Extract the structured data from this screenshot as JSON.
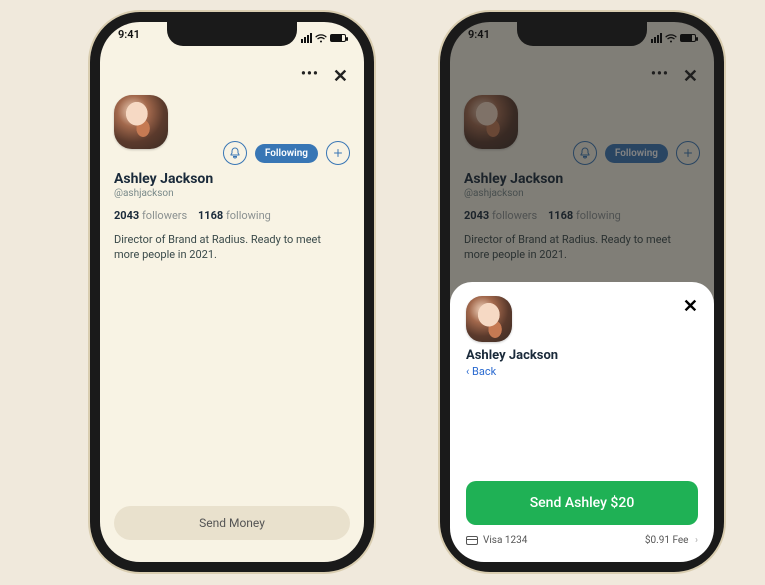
{
  "statusbar": {
    "time": "9:41"
  },
  "topbar": {
    "more": "•••",
    "close": "✕"
  },
  "profile": {
    "name": "Ashley Jackson",
    "handle": "@ashjackson",
    "followers_count": "2043",
    "followers_label": "followers",
    "following_count": "1168",
    "following_label": "following",
    "bio": "Director of Brand at Radius. Ready to meet more people in 2021.",
    "following_btn": "Following"
  },
  "bottom": {
    "send_money": "Send Money"
  },
  "sheet": {
    "name": "Ashley Jackson",
    "back": "Back",
    "send_label": "Send Ashley $20",
    "card": "Visa 1234",
    "fee": "$0.91 Fee"
  }
}
